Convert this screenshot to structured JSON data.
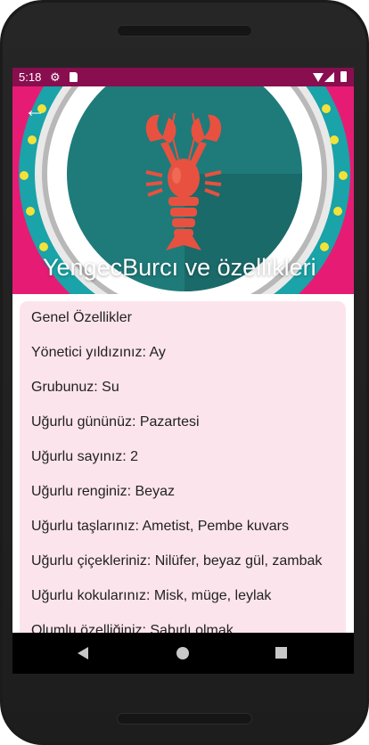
{
  "status": {
    "time": "5:18",
    "icons": [
      "settings-icon",
      "sd-card-icon",
      "wifi-icon",
      "cell-signal-icon",
      "battery-icon"
    ]
  },
  "header": {
    "title": "YengecBurcı ve özellikleri",
    "back_icon": "arrow-back-icon",
    "image": "crab-zodiac-illustration",
    "colors": {
      "background": "#e61c74",
      "ring": "#1aa3a8",
      "plate": "#1e7b7a",
      "crab": "#e8513f"
    }
  },
  "details": {
    "items": [
      "Genel Özellikler",
      "Yönetici yıldızınız: Ay",
      "Grubunuz: Su",
      "Uğurlu gününüz: Pazartesi",
      "Uğurlu sayınız: 2",
      "Uğurlu renginiz: Beyaz",
      "Uğurlu taşlarınız: Ametist, Pembe kuvars",
      "Uğurlu çiçekleriniz: Nilüfer, beyaz gül, zambak",
      "Uğurlu kokularınız: Misk, müge, leylak",
      "Olumlu özelliğiniz: Sabırlı olmak"
    ],
    "background": "#fce4ec"
  },
  "navigation": {
    "buttons": [
      "nav-back-icon",
      "nav-home-icon",
      "nav-recents-icon"
    ]
  }
}
